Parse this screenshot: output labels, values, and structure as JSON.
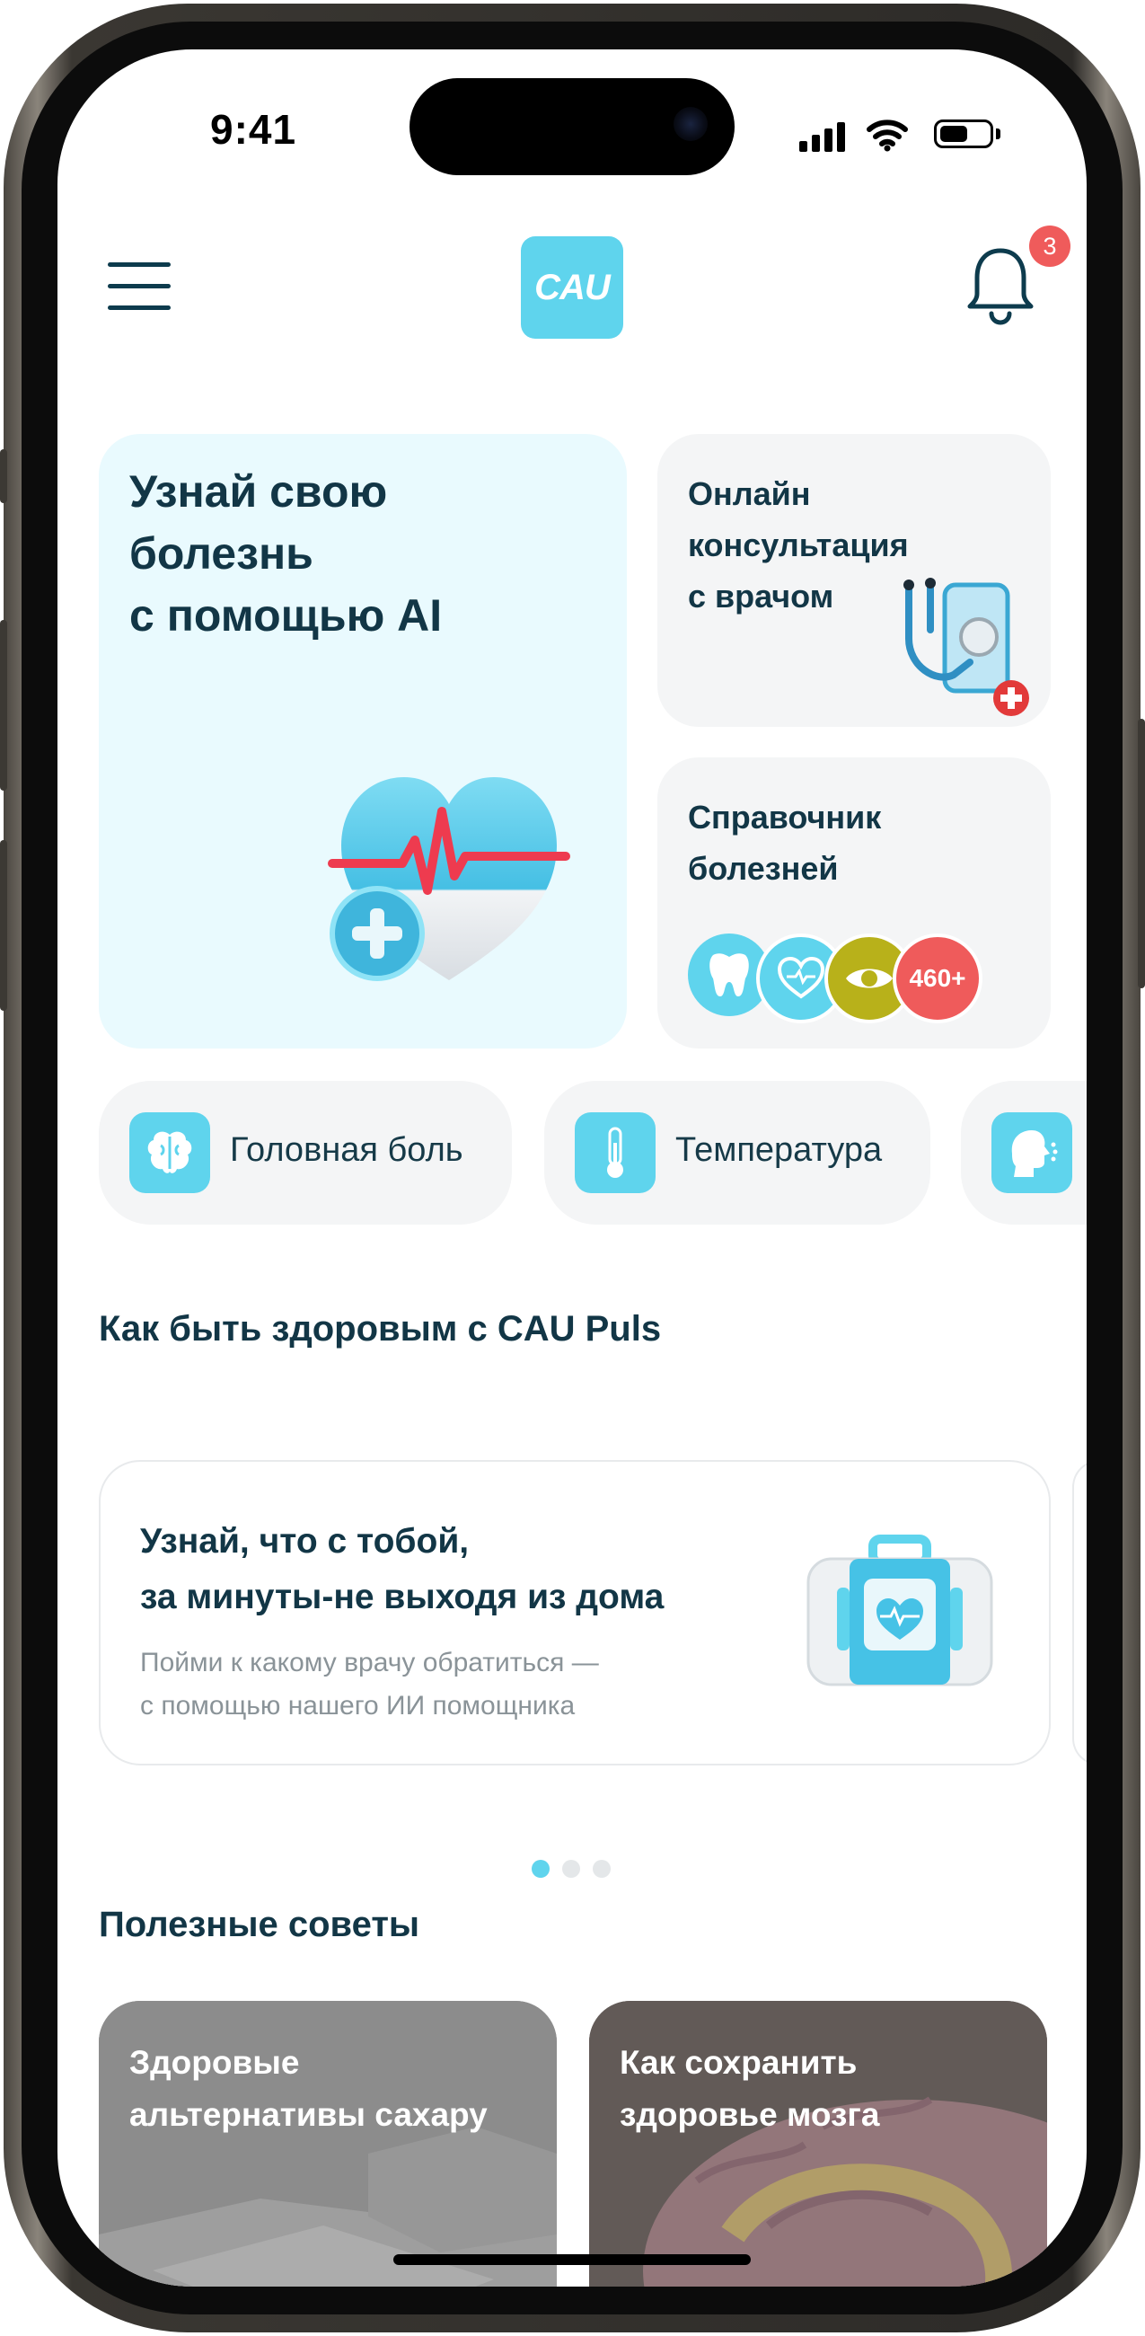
{
  "status_bar": {
    "time": "9:41"
  },
  "header": {
    "logo_text": "CAU",
    "notification_count": "3"
  },
  "hero_card": {
    "title_lines": [
      "Узнай свою",
      "болезнь",
      "с помощью AI"
    ]
  },
  "consult_card": {
    "title_lines": [
      "Онлайн",
      "консультация",
      "с врачом"
    ]
  },
  "reference_card": {
    "title_lines": [
      "Справочник",
      "болезней"
    ],
    "more_count": "460+"
  },
  "symptoms": [
    {
      "label": "Головная боль",
      "icon": "brain-icon"
    },
    {
      "label": "Температура",
      "icon": "thermometer-icon"
    },
    {
      "label": "",
      "icon": "cough-icon"
    }
  ],
  "health_section": {
    "title": "Как быть здоровым с CAU Puls",
    "promo": {
      "title_lines": [
        "Узнай, что с тобой,",
        "за минуты-не выходя из дома"
      ],
      "subtitle_lines": [
        "Пойми к какому врачу обратиться —",
        "с помощью нашего ИИ помощника"
      ]
    },
    "carousel": {
      "pages": 3,
      "active": 1
    }
  },
  "tips_section": {
    "title": "Полезные советы",
    "tips": [
      {
        "title_lines": [
          "Здоровые",
          "альтернативы сахару"
        ]
      },
      {
        "title_lines": [
          "Как сохранить",
          "здоровье мозга"
        ]
      }
    ]
  },
  "colors": {
    "accent": "#5fd4ed",
    "text_dark": "#123646",
    "badge_red": "#ef5b5b",
    "card_grey": "#f4f5f6",
    "hero_bg": "#e9fafe"
  }
}
